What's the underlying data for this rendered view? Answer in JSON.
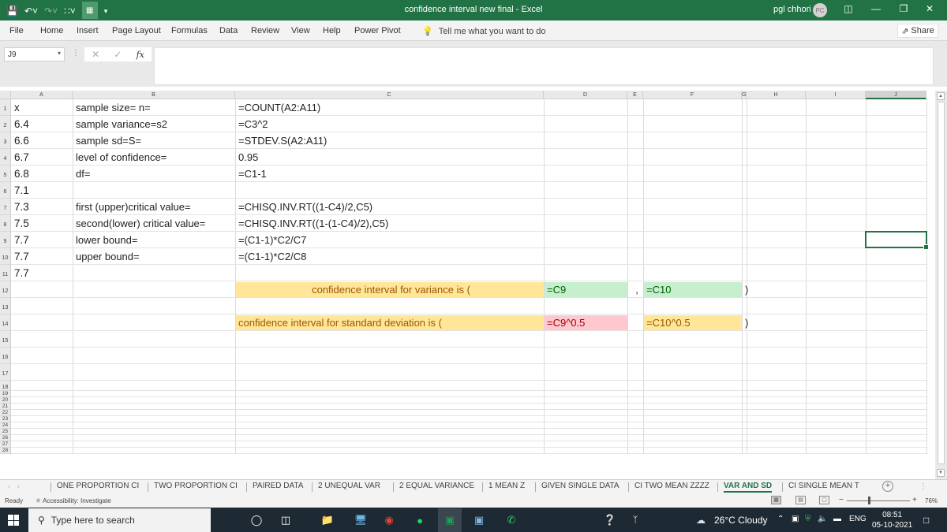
{
  "window": {
    "title": "confidence interval new final  -  Excel",
    "user_name": "pgl chhori",
    "user_initials": "PC"
  },
  "ribbon": {
    "tabs": [
      "File",
      "Home",
      "Insert",
      "Page Layout",
      "Formulas",
      "Data",
      "Review",
      "View",
      "Help",
      "Power Pivot"
    ],
    "tell_me": "Tell me what you want to do",
    "share": "Share"
  },
  "formula_bar": {
    "name_box": "J9",
    "formula": "",
    "fx": "fx"
  },
  "columns": [
    "A",
    "B",
    "C",
    "D",
    "E",
    "F",
    "G",
    "H",
    "I",
    "J"
  ],
  "selected_cell": "J9",
  "rows": [
    "1",
    "2",
    "3",
    "4",
    "5",
    "6",
    "7",
    "8",
    "9",
    "10",
    "11",
    "12",
    "13",
    "14",
    "15",
    "16",
    "17",
    "18",
    "19",
    "20",
    "21",
    "22",
    "23",
    "24",
    "25",
    "26",
    "27",
    "28"
  ],
  "cells": {
    "A": [
      "x",
      "6.4",
      "6.6",
      "6.7",
      "6.8",
      "7.1",
      "7.3",
      "7.5",
      "7.7",
      "7.7",
      "7.7"
    ],
    "B": [
      "sample size= n=",
      "sample variance=s2",
      "sample sd=S=",
      "level of confidence=",
      "df=",
      "",
      "first (upper)critical value=",
      "second(lower) critical value=",
      "lower bound=",
      "upper bound="
    ],
    "C": [
      "=COUNT(A2:A11)",
      "=C3^2",
      "=STDEV.S(A2:A11)",
      "0.95",
      "=C1-1",
      "",
      "=CHISQ.INV.RT((1-C4)/2,C5)",
      "=CHISQ.INV.RT((1-(1-C4)/2),C5)",
      "=(C1-1)*C2/C7",
      "=(C1-1)*C2/C8"
    ],
    "row12": {
      "C": "confidence interval for variance is   (",
      "D": "=C9",
      "E": ",",
      "F": "=C10",
      "G": ")"
    },
    "row14": {
      "C": "confidence interval for standard deviation is     (",
      "D": "=C9^0.5",
      "F": "=C10^0.5",
      "G": ")"
    }
  },
  "sheet_tabs": [
    "ONE PROPORTION CI",
    "TWO PROPORTION CI",
    "PAIRED DATA",
    "2 UNEQUAL VAR",
    "2 EQUAL VARIANCE",
    "1 MEAN Z",
    "GIVEN SINGLE DATA",
    "CI TWO MEAN ZZZZ",
    "VAR AND SD",
    "CI SINGLE MEAN T"
  ],
  "active_sheet": "VAR AND SD",
  "status": {
    "ready": "Ready",
    "accessibility": "Accessibility: Investigate",
    "zoom": "76%"
  },
  "taskbar": {
    "search_placeholder": "Type here to search",
    "weather": "26°C  Cloudy",
    "language": "ENG",
    "time": "08:51",
    "date": "05-10-2021"
  },
  "colors": {
    "excel_green": "#217346",
    "yellow_fill": "#ffe699",
    "green_fill": "#c6efce",
    "red_fill": "#ffc7ce"
  }
}
